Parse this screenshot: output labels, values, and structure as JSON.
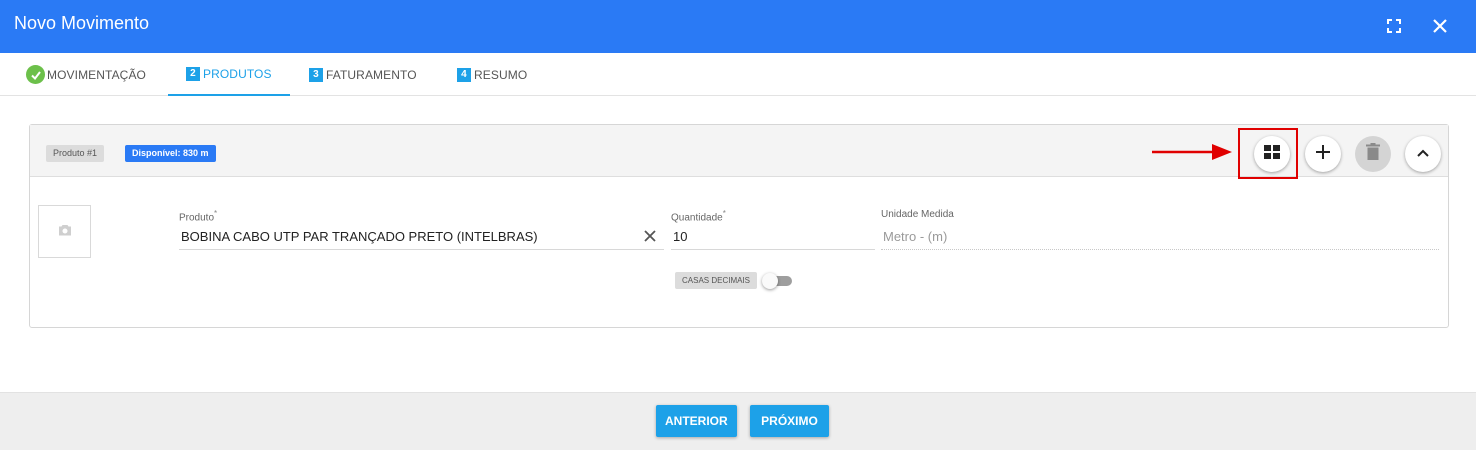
{
  "window": {
    "title": "Novo Movimento",
    "icons": [
      "fullscreen-icon",
      "close-icon"
    ]
  },
  "tabs": [
    {
      "label": "MOVIMENTAÇÃO",
      "marker": "check",
      "state": "done"
    },
    {
      "label": "PRODUTOS",
      "number": "2",
      "state": "active"
    },
    {
      "label": "FATURAMENTO",
      "number": "3",
      "state": "pending"
    },
    {
      "label": "RESUMO",
      "number": "4",
      "state": "pending"
    }
  ],
  "product_card": {
    "badge_id": "Produto #1",
    "badge_available": "Disponível: 830 m",
    "actions": [
      "grid-icon",
      "plus-icon",
      "trash-icon",
      "chevron-up-icon"
    ],
    "produto_label": "Produto",
    "produto_value": "BOBINA CABO UTP PAR TRANÇADO PRETO (INTELBRAS)",
    "quantidade_label": "Quantidade",
    "quantidade_value": "10",
    "unidade_label": "Unidade Medida",
    "unidade_value": "Metro - (m)",
    "required_mark": "*",
    "casas_decimais_label": "CASAS DECIMAIS",
    "casas_decimais_enabled": false
  },
  "footer": {
    "anterior_label": "ANTERIOR",
    "proximo_label": "PRÓXIMO"
  },
  "colors": {
    "primary": "#2a7af5",
    "accent": "#1da1e8",
    "success": "#6cc04a",
    "highlight": "#e00000"
  }
}
